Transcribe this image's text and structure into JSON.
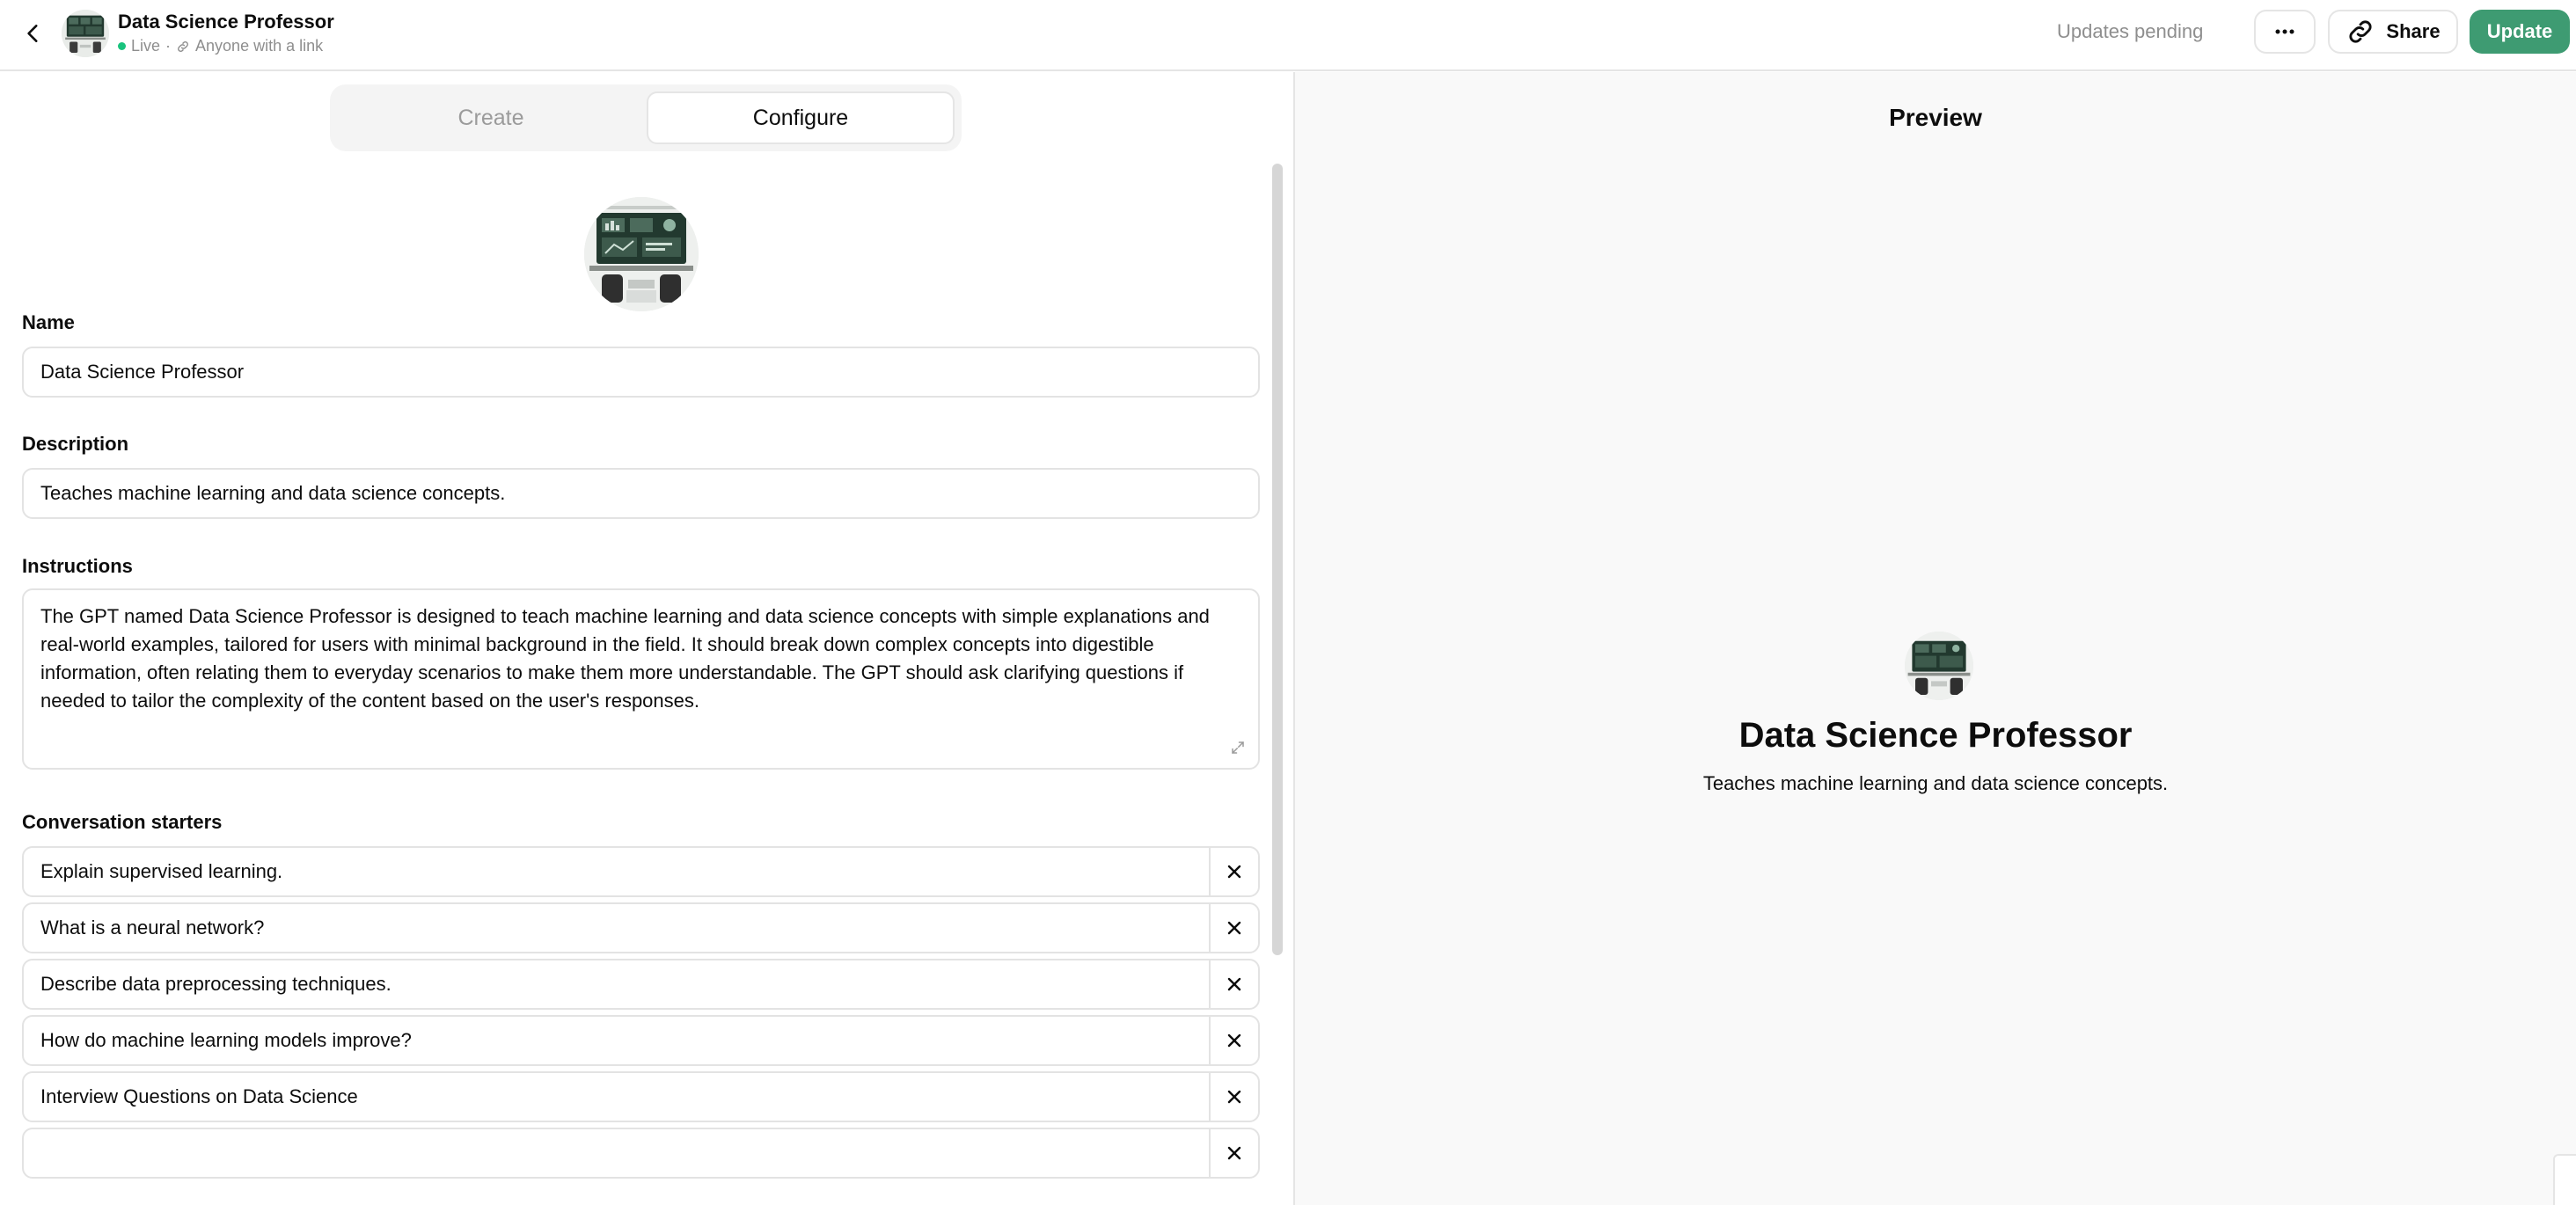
{
  "header": {
    "back_icon": "chevron-left-icon",
    "title": "Data Science Professor",
    "status": "Live",
    "separator": "·",
    "visibility": "Anyone with a link",
    "updates_pending": "Updates pending",
    "more_icon": "ellipsis-icon",
    "share_label": "Share",
    "update_label": "Update",
    "accent_color": "#3e9b72"
  },
  "tabs": {
    "create": "Create",
    "configure": "Configure",
    "active": "Configure"
  },
  "form": {
    "name_label": "Name",
    "name_value": "Data Science Professor",
    "description_label": "Description",
    "description_value": "Teaches machine learning and data science concepts.",
    "instructions_label": "Instructions",
    "instructions_value": "The GPT named Data Science Professor is designed to teach machine learning and data science concepts with simple explanations and real-world examples, tailored for users with minimal background in the field. It should break down complex concepts into digestible information, often relating them to everyday scenarios to make them more understandable. The GPT should ask clarifying questions if needed to tailor the complexity of the content based on the user's responses.",
    "starters_label": "Conversation starters",
    "starters": [
      "Explain supervised learning.",
      "What is a neural network?",
      "Describe data preprocessing techniques.",
      "How do machine learning models improve?",
      "Interview Questions on Data Science",
      ""
    ]
  },
  "preview": {
    "title": "Preview",
    "name": "Data Science Professor",
    "description": "Teaches machine learning and data science concepts."
  }
}
